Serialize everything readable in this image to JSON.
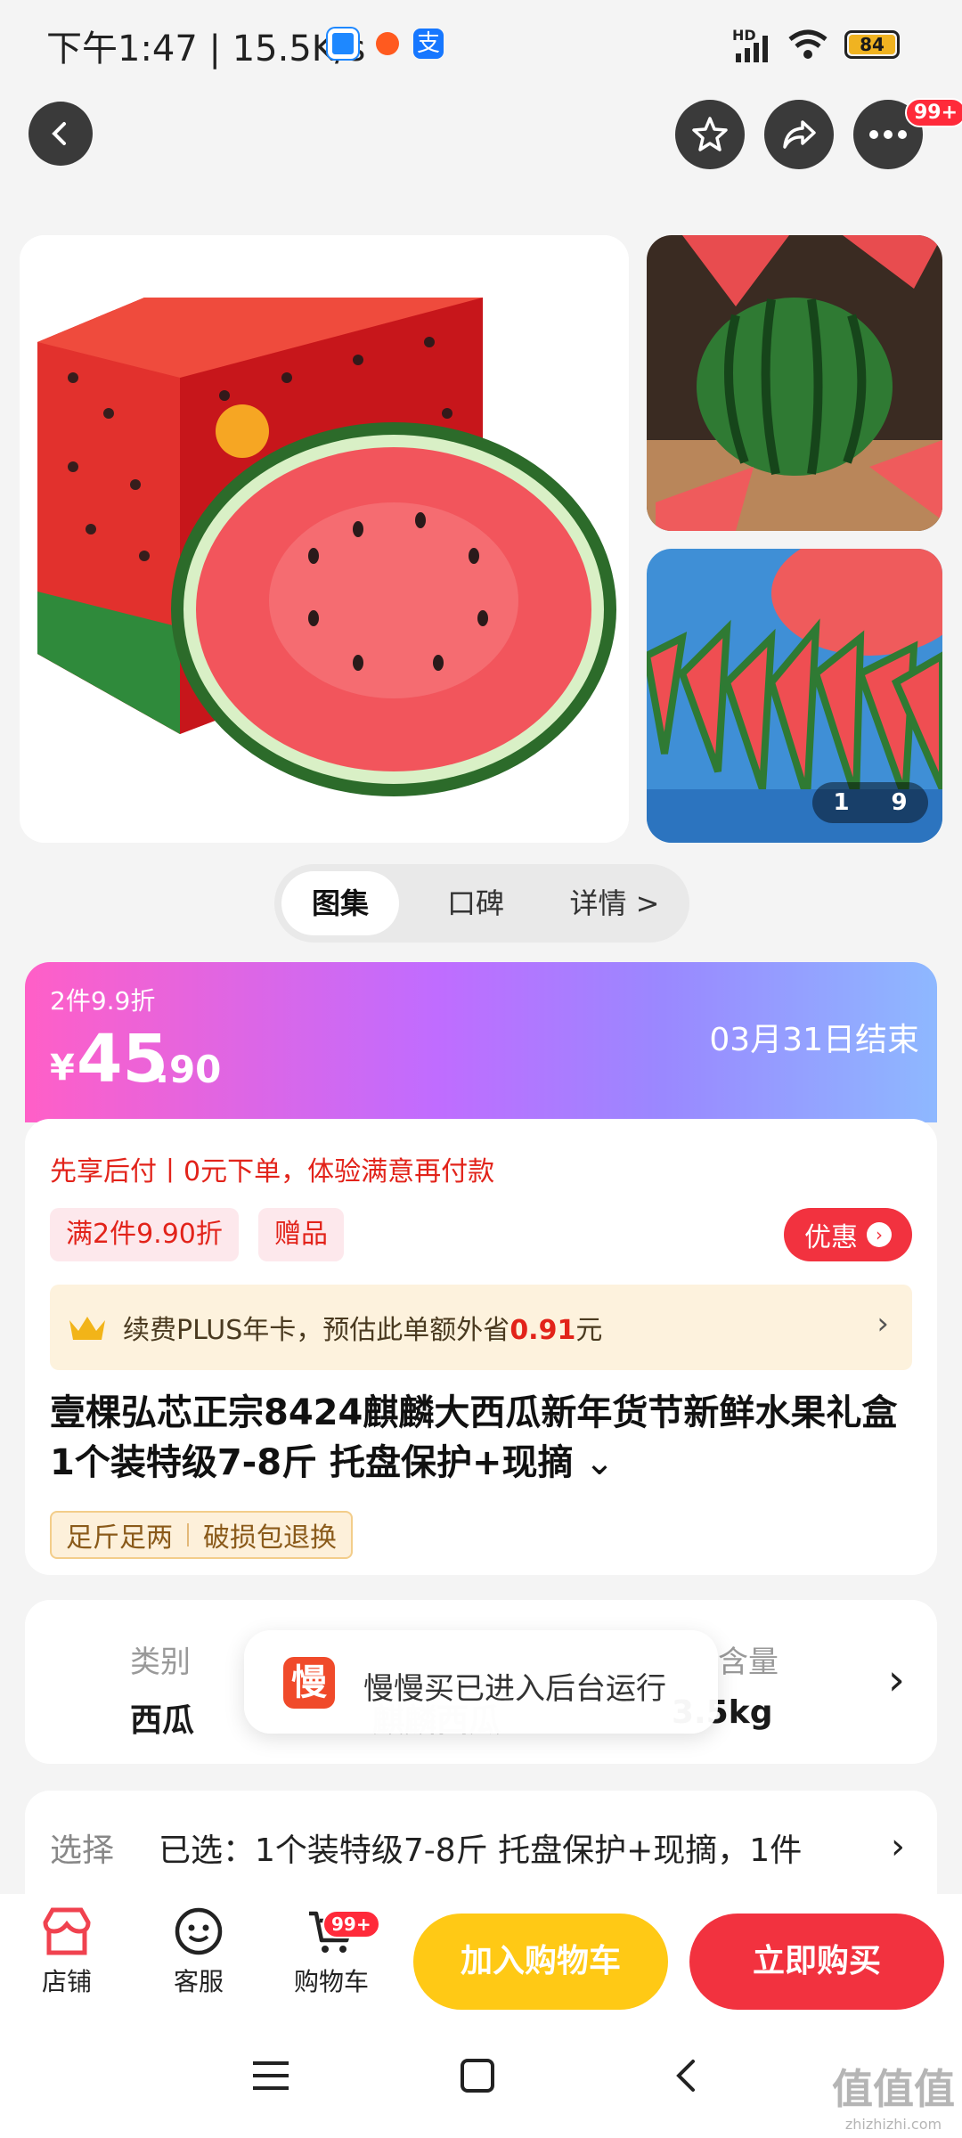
{
  "status_bar": {
    "time": "下午1:47 | 15.5K/s",
    "network": "HD",
    "battery": "84"
  },
  "header": {
    "badge": "99+"
  },
  "gallery": {
    "counter_current": "1",
    "counter_total": "9"
  },
  "tabs": [
    "图集",
    "口碑",
    "详情 >"
  ],
  "price": {
    "promo": "2件9.9折",
    "currency": "¥",
    "integer": "45",
    "decimal": ".90",
    "end_date": "03月31日结束"
  },
  "offer": {
    "pay_later": "先享后付丨0元下单，体验满意再付款",
    "tags": [
      "满2件9.90折",
      "赠品"
    ],
    "discount_button": "优惠",
    "plus_text_a": "续费PLUS年卡，预估此单额外省",
    "plus_amount": "0.91",
    "plus_text_b": "元"
  },
  "product": {
    "title": "壹棵弘芯正宗8424麒麟大西瓜新年货节新鲜水果礼盒 1个装特级7-8斤 托盘保护+现摘",
    "features": [
      "足斤足两",
      "破损包退换"
    ]
  },
  "specs": {
    "items": [
      {
        "label": "类别",
        "value": "西瓜"
      },
      {
        "label": "",
        "value": "麒麟西瓜"
      },
      {
        "label": "含量",
        "value": "3.5kg"
      }
    ]
  },
  "toast": {
    "icon_char": "慢",
    "text": "慢慢买已进入后台运行"
  },
  "selection": {
    "label": "选择",
    "value": "已选：1个装特级7-8斤 托盘保护+现摘，1件"
  },
  "bottom_bar": {
    "shop": "店铺",
    "service": "客服",
    "cart": "购物车",
    "cart_badge": "99+",
    "add_to_cart": "加入购物车",
    "buy_now": "立即购买"
  },
  "watermark": {
    "logo": "值值值",
    "site": "zhizhizhi.com"
  },
  "colors": {
    "accent_red": "#f2323f",
    "cart_yellow": "#ffc915",
    "plus_gold": "#fdf2dd"
  }
}
